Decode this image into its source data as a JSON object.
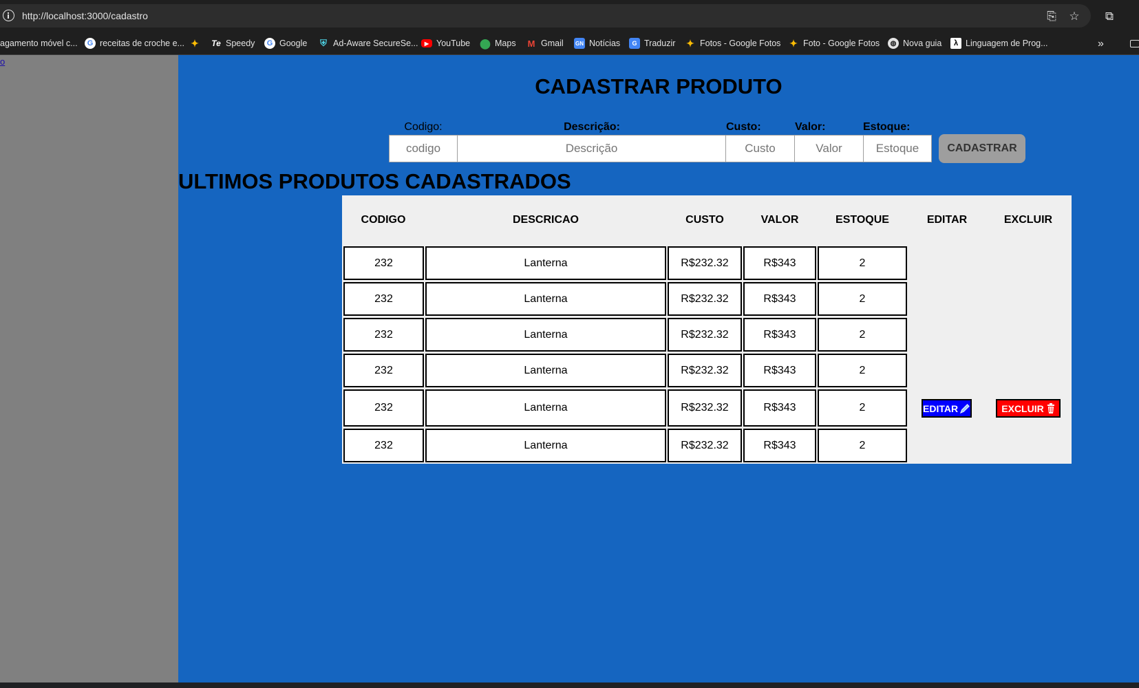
{
  "browser": {
    "url": "http://localhost:3000/cadastro",
    "bookmarks": [
      {
        "label": "agamento móvel c..."
      },
      {
        "label": "receitas de croche e..."
      },
      {
        "label": ""
      },
      {
        "label": "Speedy"
      },
      {
        "label": "Google"
      },
      {
        "label": "Ad-Aware SecureSe..."
      },
      {
        "label": "YouTube"
      },
      {
        "label": "Maps"
      },
      {
        "label": "Gmail"
      },
      {
        "label": "Notícias"
      },
      {
        "label": "Traduzir"
      },
      {
        "label": "Fotos - Google Fotos"
      },
      {
        "label": "Foto - Google Fotos"
      },
      {
        "label": "Nova guia"
      },
      {
        "label": "Linguagem de Prog..."
      }
    ]
  },
  "sidebar": {
    "link": "o"
  },
  "form": {
    "title": "CADASTRAR PRODUTO",
    "fields": [
      {
        "label": "Codigo:",
        "placeholder": "codigo"
      },
      {
        "label": "Descrição:",
        "placeholder": "Descrição"
      },
      {
        "label": "Custo:",
        "placeholder": "Custo"
      },
      {
        "label": "Valor:",
        "placeholder": "Valor"
      },
      {
        "label": "Estoque:",
        "placeholder": "Estoque"
      }
    ],
    "submit_label": "CADASTRAR"
  },
  "products": {
    "title": "ULTIMOS PRODUTOS CADASTRADOS",
    "columns": [
      "CODIGO",
      "DESCRICAO",
      "CUSTO",
      "VALOR",
      "ESTOQUE",
      "EDITAR",
      "EXCLUIR"
    ],
    "rows": [
      {
        "codigo": "232",
        "descricao": "Lanterna",
        "custo": "R$232.32",
        "valor": "R$343",
        "estoque": "2"
      },
      {
        "codigo": "232",
        "descricao": "Lanterna",
        "custo": "R$232.32",
        "valor": "R$343",
        "estoque": "2"
      },
      {
        "codigo": "232",
        "descricao": "Lanterna",
        "custo": "R$232.32",
        "valor": "R$343",
        "estoque": "2"
      },
      {
        "codigo": "232",
        "descricao": "Lanterna",
        "custo": "R$232.32",
        "valor": "R$343",
        "estoque": "2"
      },
      {
        "codigo": "232",
        "descricao": "Lanterna",
        "custo": "R$232.32",
        "valor": "R$343",
        "estoque": "2"
      },
      {
        "codigo": "232",
        "descricao": "Lanterna",
        "custo": "R$232.32",
        "valor": "R$343",
        "estoque": "2"
      }
    ],
    "edit_label": "EDITAR",
    "delete_label": "EXCLUIR"
  },
  "colors": {
    "page_background": "#1565c0",
    "sidebar": "#808080",
    "table_background": "#efefef",
    "edit_button": "#0000ff",
    "delete_button": "#ff0000",
    "submit_button": "#9e9e9e"
  }
}
